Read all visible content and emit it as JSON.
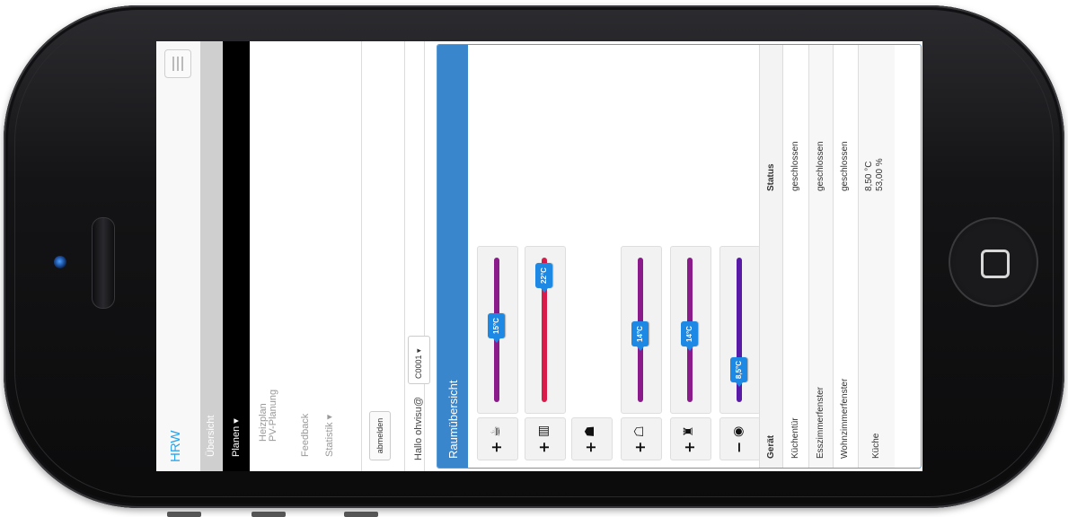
{
  "app": {
    "brand": "HRW"
  },
  "nav": {
    "items": [
      {
        "label": "Übersicht"
      },
      {
        "label": "Planen ▾"
      },
      {
        "label": "Heizplan"
      },
      {
        "label": "PV-Planung"
      },
      {
        "label": "Feedback"
      },
      {
        "label": "Statistik ▾"
      }
    ],
    "logout_label": "abmelden",
    "greeting": "Hallo ohvisu@",
    "select_value": "C0001 ▾"
  },
  "panel": {
    "title": "Raumübersicht",
    "devices": [
      {
        "sign": "+",
        "icon": "☕",
        "icon_name": "kettle-icon"
      },
      {
        "sign": "+",
        "icon": "▥",
        "icon_name": "appliance-icon"
      },
      {
        "sign": "+",
        "icon": "☗",
        "icon_name": "house-icon"
      },
      {
        "sign": "+",
        "icon": "☖",
        "icon_name": "house-outline-icon"
      },
      {
        "sign": "+",
        "icon": "♜",
        "icon_name": "tower-icon"
      },
      {
        "sign": "−",
        "icon": "◉",
        "icon_name": "fan-icon"
      }
    ],
    "sliders": [
      {
        "label": "15°C",
        "level": 0.5,
        "color": "#8b1a8b"
      },
      {
        "label": "22°C",
        "level": 0.85,
        "color": "#d81b4a"
      },
      null,
      {
        "label": "14°C",
        "level": 0.45,
        "color": "#8b1a8b"
      },
      {
        "label": "14°C",
        "level": 0.45,
        "color": "#8b1a8b"
      },
      {
        "label": "8,5°C",
        "level": 0.2,
        "color": "#5a1aa8"
      }
    ]
  },
  "table": {
    "headers": [
      "Gerät",
      "Status"
    ],
    "rows": [
      {
        "device": "Küchentür",
        "status": "geschlossen"
      },
      {
        "device": "Esszimmerfenster",
        "status": "geschlossen"
      },
      {
        "device": "Wohnzimmerfenster",
        "status": "geschlossen"
      },
      {
        "device": "Küche",
        "status": "8,50 °C",
        "status2": "53,00 %"
      }
    ]
  }
}
